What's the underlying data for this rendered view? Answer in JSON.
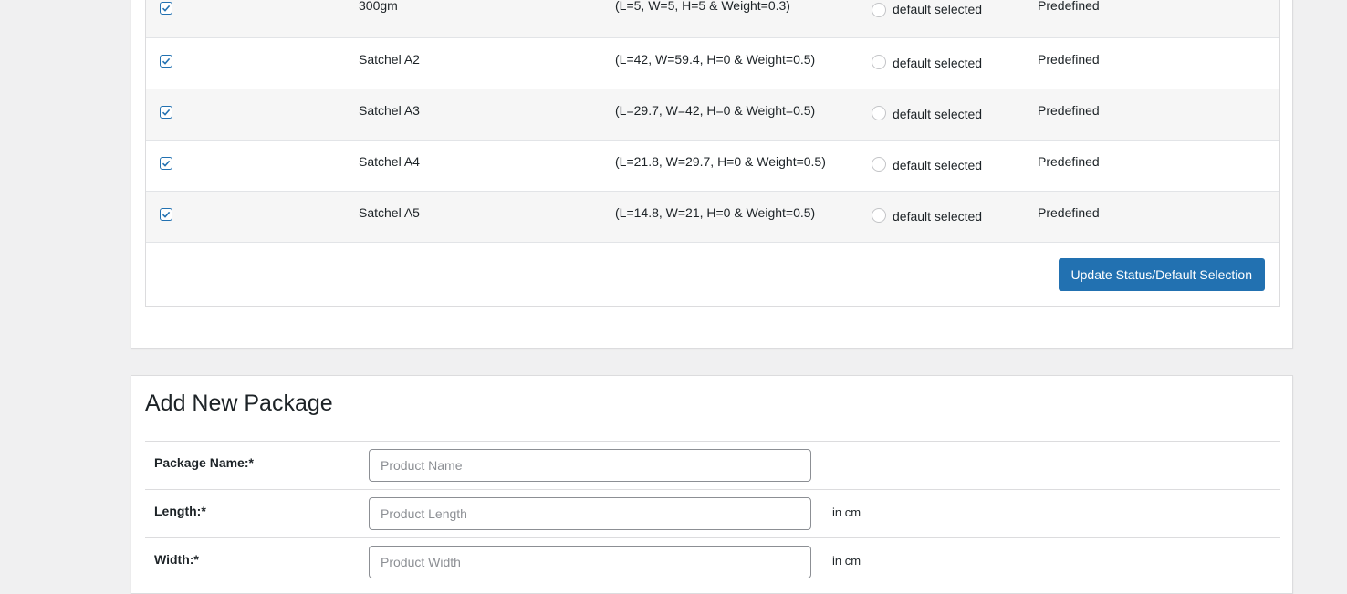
{
  "packages": {
    "rows": [
      {
        "name": "300gm",
        "dimensions": "(L=5, W=5, H=5 & Weight=0.3)",
        "default_label": "default selected",
        "type": "Predefined"
      },
      {
        "name": "Satchel A2",
        "dimensions": "(L=42, W=59.4, H=0 & Weight=0.5)",
        "default_label": "default selected",
        "type": "Predefined"
      },
      {
        "name": "Satchel A3",
        "dimensions": "(L=29.7, W=42, H=0 & Weight=0.5)",
        "default_label": "default selected",
        "type": "Predefined"
      },
      {
        "name": "Satchel A4",
        "dimensions": "(L=21.8, W=29.7, H=0 & Weight=0.5)",
        "default_label": "default selected",
        "type": "Predefined"
      },
      {
        "name": "Satchel A5",
        "dimensions": "(L=14.8, W=21, H=0 & Weight=0.5)",
        "default_label": "default selected",
        "type": "Predefined"
      }
    ],
    "update_button": "Update Status/Default Selection"
  },
  "add_package": {
    "title": "Add New Package",
    "fields": [
      {
        "label": "Package Name:*",
        "placeholder": "Product Name",
        "unit": ""
      },
      {
        "label": "Length:*",
        "placeholder": "Product Length",
        "unit": "in cm"
      },
      {
        "label": "Width:*",
        "placeholder": "Product Width",
        "unit": "in cm"
      }
    ]
  },
  "colors": {
    "accent": "#2271b1",
    "background": "#f0f0f1"
  }
}
